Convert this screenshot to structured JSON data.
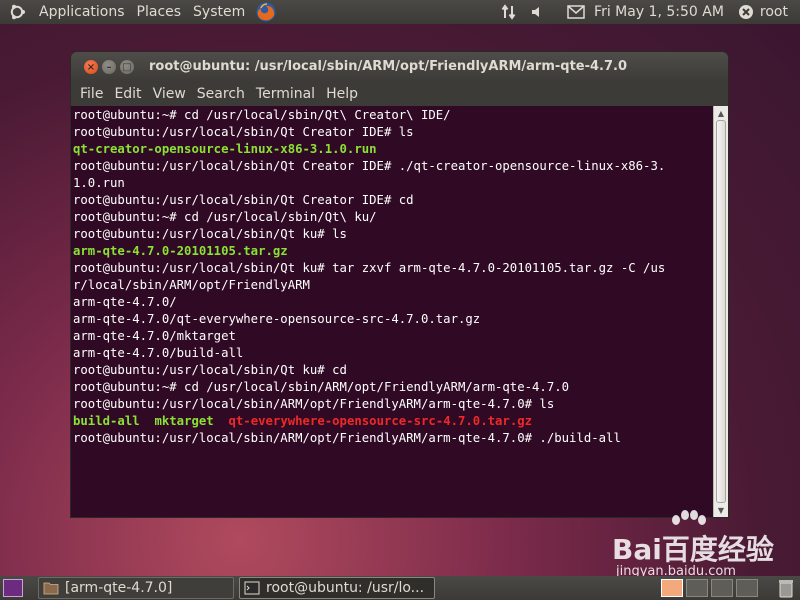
{
  "top_panel": {
    "menus": [
      "Applications",
      "Places",
      "System"
    ],
    "clock": "Fri May  1,  5:50 AM",
    "user": "root"
  },
  "window": {
    "title": "root@ubuntu: /usr/local/sbin/ARM/opt/FriendlyARM/arm-qte-4.7.0",
    "menu": [
      "File",
      "Edit",
      "View",
      "Search",
      "Terminal",
      "Help"
    ]
  },
  "terminal": {
    "lines": [
      [
        {
          "t": "root@ubuntu:~# cd /usr/local/sbin/Qt\\ Creator\\ IDE/",
          "c": ""
        }
      ],
      [
        {
          "t": "root@ubuntu:/usr/local/sbin/Qt Creator IDE# ls",
          "c": ""
        }
      ],
      [
        {
          "t": "qt-creator-opensource-linux-x86-3.1.0.run",
          "c": "green"
        }
      ],
      [
        {
          "t": "root@ubuntu:/usr/local/sbin/Qt Creator IDE# ./qt-creator-opensource-linux-x86-3.",
          "c": ""
        }
      ],
      [
        {
          "t": "1.0.run",
          "c": ""
        }
      ],
      [
        {
          "t": "root@ubuntu:/usr/local/sbin/Qt Creator IDE# cd",
          "c": ""
        }
      ],
      [
        {
          "t": "root@ubuntu:~# cd /usr/local/sbin/Qt\\ ku/",
          "c": ""
        }
      ],
      [
        {
          "t": "root@ubuntu:/usr/local/sbin/Qt ku# ls",
          "c": ""
        }
      ],
      [
        {
          "t": "arm-qte-4.7.0-20101105.tar.gz",
          "c": "green"
        }
      ],
      [
        {
          "t": "root@ubuntu:/usr/local/sbin/Qt ku# tar zxvf arm-qte-4.7.0-20101105.tar.gz -C /us",
          "c": ""
        }
      ],
      [
        {
          "t": "r/local/sbin/ARM/opt/FriendlyARM",
          "c": ""
        }
      ],
      [
        {
          "t": "arm-qte-4.7.0/",
          "c": ""
        }
      ],
      [
        {
          "t": "arm-qte-4.7.0/qt-everywhere-opensource-src-4.7.0.tar.gz",
          "c": ""
        }
      ],
      [
        {
          "t": "arm-qte-4.7.0/mktarget",
          "c": ""
        }
      ],
      [
        {
          "t": "arm-qte-4.7.0/build-all",
          "c": ""
        }
      ],
      [
        {
          "t": "root@ubuntu:/usr/local/sbin/Qt ku# cd",
          "c": ""
        }
      ],
      [
        {
          "t": "root@ubuntu:~# cd /usr/local/sbin/ARM/opt/FriendlyARM/arm-qte-4.7.0",
          "c": ""
        }
      ],
      [
        {
          "t": "root@ubuntu:/usr/local/sbin/ARM/opt/FriendlyARM/arm-qte-4.7.0# ls",
          "c": ""
        }
      ],
      [
        {
          "t": "build-all",
          "c": "green"
        },
        {
          "t": "  ",
          "c": ""
        },
        {
          "t": "mktarget",
          "c": "green"
        },
        {
          "t": "  ",
          "c": ""
        },
        {
          "t": "qt-everywhere-opensource-src-4.7.0.tar.gz",
          "c": "red"
        }
      ],
      [
        {
          "t": "root@ubuntu:/usr/local/sbin/ARM/opt/FriendlyARM/arm-qte-4.7.0# ./build-all",
          "c": ""
        }
      ]
    ]
  },
  "bottom_panel": {
    "task_files": "[arm-qte-4.7.0]",
    "task_terminal": "root@ubuntu: /usr/lo..."
  },
  "watermark": {
    "main": "Bai百度经验",
    "sub": "jingyan.baidu.com"
  },
  "colors": {
    "terminal_bg": "#300a24",
    "executable": "#8ae234",
    "archive": "#ef2929"
  }
}
